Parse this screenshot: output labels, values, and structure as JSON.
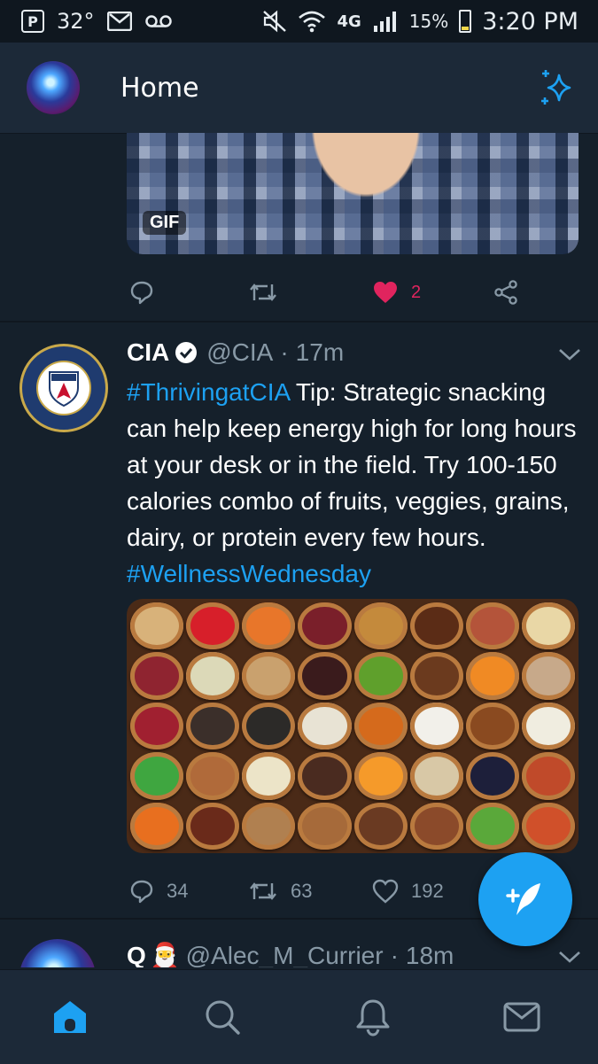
{
  "status_bar": {
    "temperature": "32°",
    "network": "4G",
    "battery": "15%",
    "time": "3:20 PM",
    "icons": [
      "parking-icon",
      "gmail-icon",
      "voicemail-icon",
      "mute-icon",
      "wifi-icon",
      "signal-icon",
      "battery-icon"
    ]
  },
  "header": {
    "title": "Home",
    "left_icon": "profile-avatar",
    "right_icon": "sparkle-icon"
  },
  "tweets": [
    {
      "media_badge": "GIF",
      "actions": {
        "reply": "",
        "retweet": "",
        "like": "2",
        "liked": true
      }
    },
    {
      "name": "CIA",
      "verified": true,
      "handle": "@CIA",
      "separator": "·",
      "time": "17m",
      "text_parts": {
        "hashtag1": "#ThrivingatCIA",
        "body": " Tip: Strategic snacking can help keep energy high for long hours at your desk or in the field. Try 100-150 calories combo of fruits, veggies, grains, dairy, or protein every few hours. ",
        "hashtag2": "#WellnessWednesday"
      },
      "actions": {
        "reply": "34",
        "retweet": "63",
        "like": "192"
      }
    },
    {
      "name": "Q",
      "emoji": "🎅",
      "handle": "@Alec_M_Currier",
      "separator": "·",
      "time": "18m"
    }
  ],
  "bottom_nav": [
    "home-icon",
    "search-icon",
    "notifications-icon",
    "messages-icon"
  ],
  "colors": {
    "background": "#15202b",
    "bar": "#1c2938",
    "accent": "#1da1f2",
    "like": "#e0245e",
    "muted": "#8899a6"
  }
}
